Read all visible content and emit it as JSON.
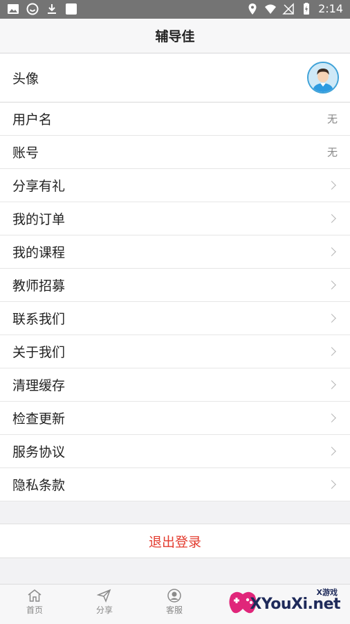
{
  "statusbar": {
    "time": "2:14"
  },
  "header": {
    "title": "辅导佳"
  },
  "profile": {
    "avatar_label": "头像"
  },
  "rows": [
    {
      "label": "用户名",
      "value": "无"
    },
    {
      "label": "账号",
      "value": "无"
    },
    {
      "label": "分享有礼"
    },
    {
      "label": "我的订单"
    },
    {
      "label": "我的课程"
    },
    {
      "label": "教师招募"
    },
    {
      "label": "联系我们"
    },
    {
      "label": "关于我们"
    },
    {
      "label": "清理缓存"
    },
    {
      "label": "检查更新"
    },
    {
      "label": "服务协议"
    },
    {
      "label": "隐私条款"
    }
  ],
  "logout": {
    "label": "退出登录"
  },
  "tabbar": {
    "home": "首页",
    "share": "分享",
    "service": "客服"
  },
  "watermark": {
    "brand": "XYouXi.net",
    "tag": "X游戏"
  },
  "colors": {
    "accent_red": "#e33b2e",
    "avatar_ring": "#3fa2d8"
  }
}
